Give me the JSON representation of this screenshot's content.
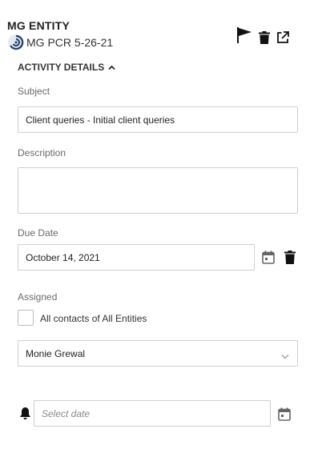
{
  "header": {
    "entity_title": "MG ENTITY",
    "record_name": "MG PCR 5-26-21",
    "icons": [
      "flag-icon",
      "trash-icon",
      "open-external-icon"
    ]
  },
  "section": {
    "title": "ACTIVITY DETAILS",
    "expanded": true
  },
  "fields": {
    "subject_label": "Subject",
    "subject_value": "Client queries - Initial client queries",
    "description_label": "Description",
    "description_value": "",
    "due_date_label": "Due Date",
    "due_date_value": "October 14, 2021",
    "assigned_label": "Assigned",
    "all_contacts_label": "All contacts of All Entities",
    "all_contacts_checked": false,
    "assignee_value": "Monie Grewal",
    "reminder_placeholder": "Select date"
  },
  "colors": {
    "text": "#333333",
    "label": "#6b6b6b",
    "border": "#cfcfcf",
    "icon_dark": "#111111",
    "icon_grey": "#666666",
    "record_icon_blue": "#1f3f6e"
  }
}
